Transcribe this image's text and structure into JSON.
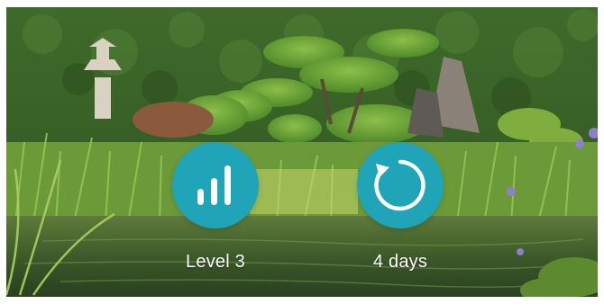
{
  "background": {
    "kind": "photo",
    "subject": "japanese-garden-pond"
  },
  "stats": {
    "level": {
      "icon": "signal-bars-icon",
      "label": "Level 3"
    },
    "frequency": {
      "icon": "refresh-circle-icon",
      "label": "4 days"
    }
  },
  "colors": {
    "badge": "#1fa4b8",
    "icon": "#ffffff",
    "text": "#ffffff"
  }
}
